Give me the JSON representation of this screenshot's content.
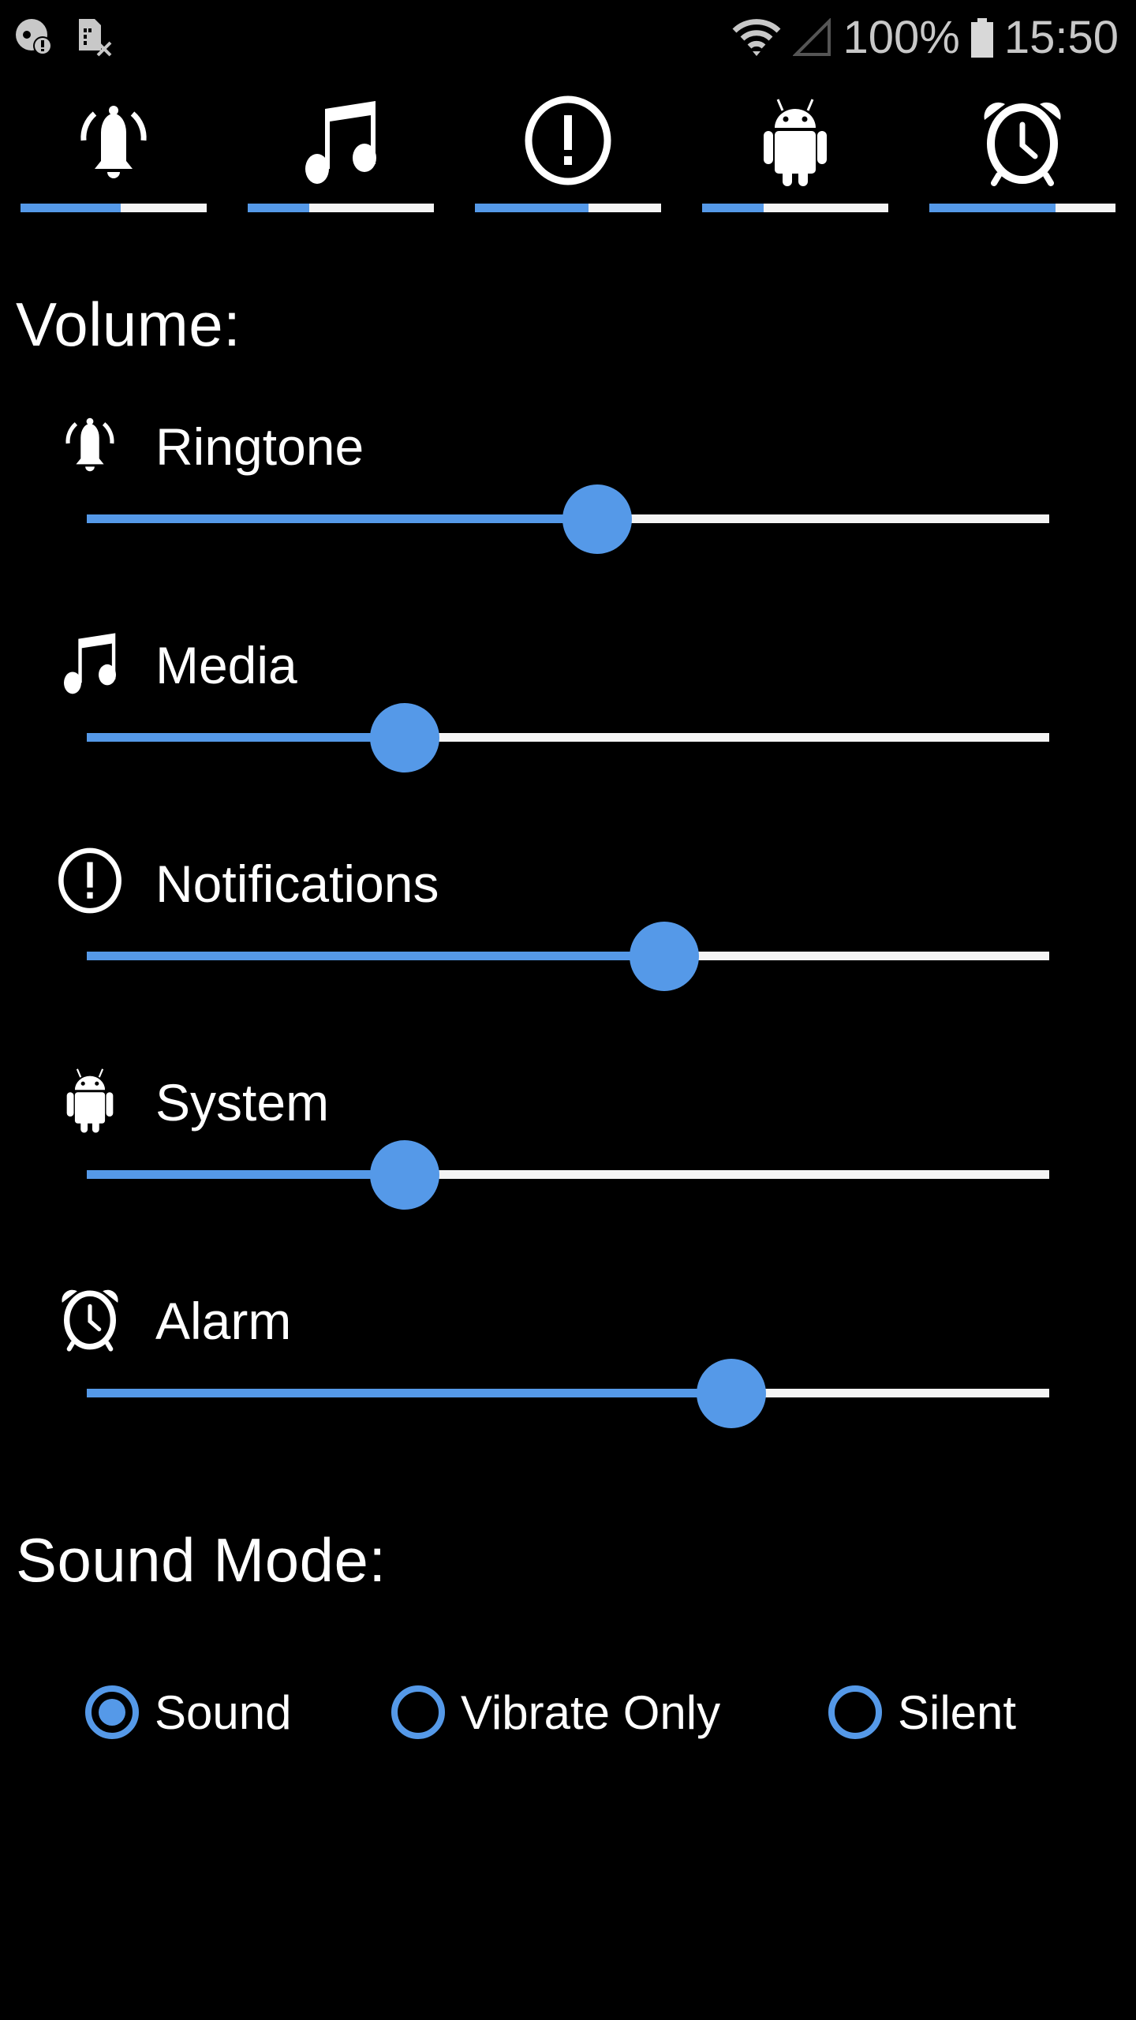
{
  "status_bar": {
    "left_icons": [
      "sd-card-warning-icon",
      "no-sim-icon"
    ],
    "right_icons": [
      "wifi-icon",
      "cell-signal-empty-icon",
      "battery-icon"
    ],
    "battery_percent": "100%",
    "time": "15:50"
  },
  "tabs": [
    {
      "name": "Ringtone",
      "icon": "bell-ringing-icon",
      "level": 0.54
    },
    {
      "name": "Media",
      "icon": "music-note-icon",
      "level": 0.33
    },
    {
      "name": "Notifications",
      "icon": "alert-circle-icon",
      "level": 0.61
    },
    {
      "name": "System",
      "icon": "android-icon",
      "level": 0.33
    },
    {
      "name": "Alarm",
      "icon": "alarm-clock-icon",
      "level": 0.68
    }
  ],
  "volume": {
    "title": "Volume:",
    "rows": [
      {
        "label": "Ringtone",
        "icon": "bell-ringing-icon",
        "level": 0.53
      },
      {
        "label": "Media",
        "icon": "music-note-icon",
        "level": 0.33
      },
      {
        "label": "Notifications",
        "icon": "alert-circle-icon",
        "level": 0.6
      },
      {
        "label": "System",
        "icon": "android-icon",
        "level": 0.33
      },
      {
        "label": "Alarm",
        "icon": "alarm-clock-icon",
        "level": 0.67
      }
    ]
  },
  "sound_mode": {
    "title": "Sound Mode:",
    "options": [
      {
        "label": "Sound",
        "selected": true
      },
      {
        "label": "Vibrate Only",
        "selected": false
      },
      {
        "label": "Silent",
        "selected": false
      }
    ]
  },
  "colors": {
    "accent": "#5599e8",
    "track": "#f4f4f4",
    "background": "#000000",
    "status_text": "#c8c8c8"
  }
}
